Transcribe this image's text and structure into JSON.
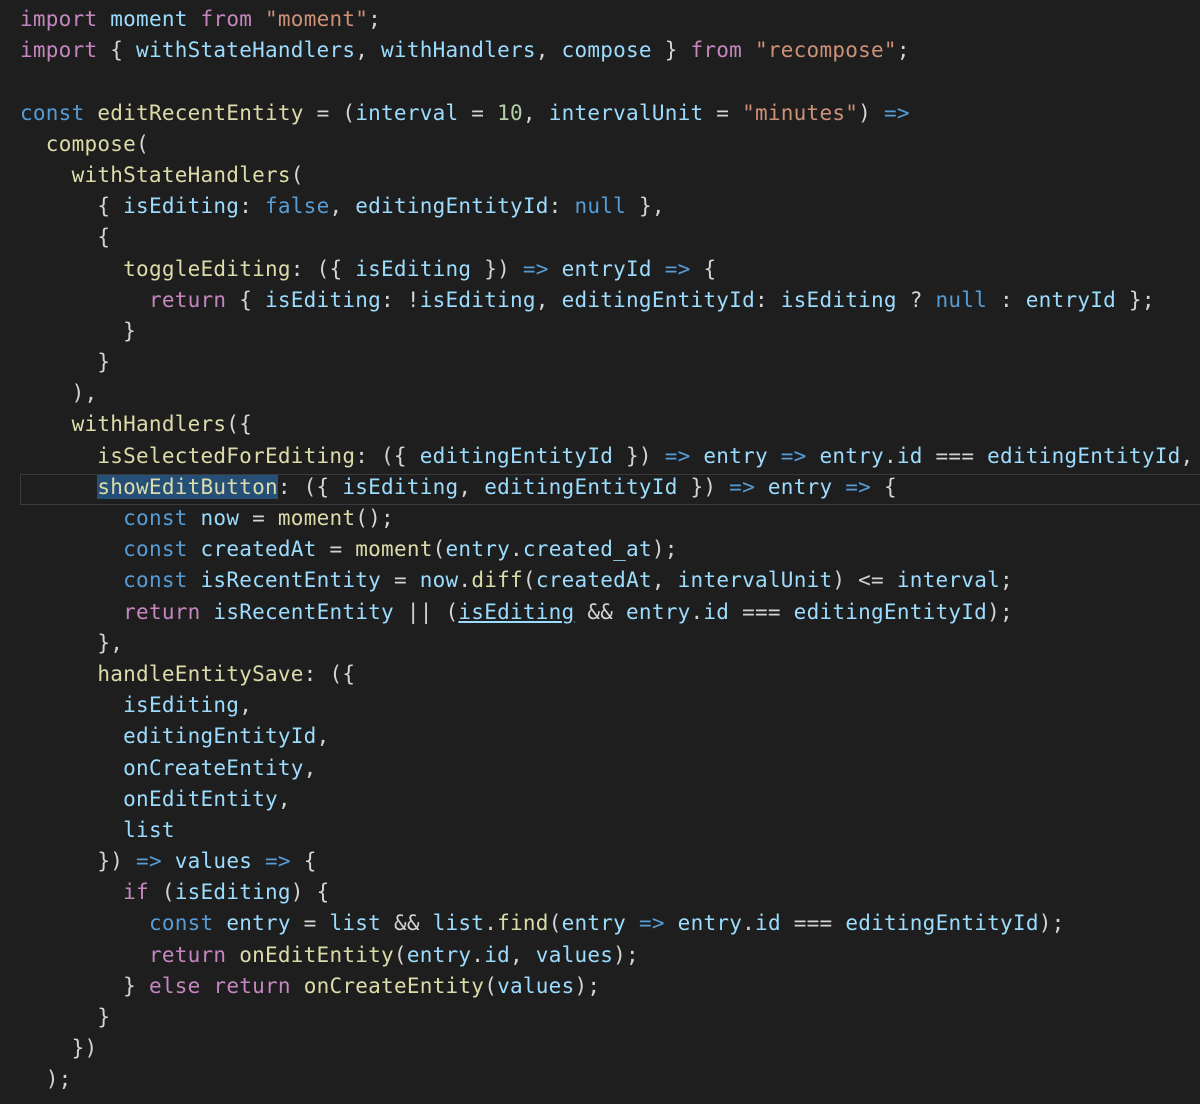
{
  "editor": {
    "theme_colors": {
      "background": "#1e1e1e",
      "keyword": "#c586c0",
      "storage": "#569cd6",
      "function": "#dcdcaa",
      "variable": "#9cdcfe",
      "string": "#ce9178",
      "number": "#b5cea8",
      "punctuation": "#d4d4d4"
    },
    "current_line": 16,
    "lines": [
      [
        [
          "kw",
          "import"
        ],
        [
          "pl",
          " "
        ],
        [
          "vr",
          "moment"
        ],
        [
          "pl",
          " "
        ],
        [
          "kw",
          "from"
        ],
        [
          "pl",
          " "
        ],
        [
          "str",
          "\"moment\""
        ],
        [
          "pl",
          ";"
        ]
      ],
      [
        [
          "kw",
          "import"
        ],
        [
          "pl",
          " { "
        ],
        [
          "vr",
          "withStateHandlers"
        ],
        [
          "pl",
          ", "
        ],
        [
          "vr",
          "withHandlers"
        ],
        [
          "pl",
          ", "
        ],
        [
          "vr",
          "compose"
        ],
        [
          "pl",
          " } "
        ],
        [
          "kw",
          "from"
        ],
        [
          "pl",
          " "
        ],
        [
          "str",
          "\"recompose\""
        ],
        [
          "pl",
          ";"
        ]
      ],
      [
        [
          "pl",
          ""
        ]
      ],
      [
        [
          "st",
          "const"
        ],
        [
          "pl",
          " "
        ],
        [
          "fn",
          "editRecentEntity"
        ],
        [
          "pl",
          " = ("
        ],
        [
          "vr",
          "interval"
        ],
        [
          "pl",
          " = "
        ],
        [
          "num",
          "10"
        ],
        [
          "pl",
          ", "
        ],
        [
          "vr",
          "intervalUnit"
        ],
        [
          "pl",
          " = "
        ],
        [
          "str",
          "\"minutes\""
        ],
        [
          "pl",
          ") "
        ],
        [
          "ar",
          "=>"
        ]
      ],
      [
        [
          "pl",
          "  "
        ],
        [
          "fn",
          "compose"
        ],
        [
          "pl",
          "("
        ]
      ],
      [
        [
          "pl",
          "    "
        ],
        [
          "fn",
          "withStateHandlers"
        ],
        [
          "pl",
          "("
        ]
      ],
      [
        [
          "pl",
          "      { "
        ],
        [
          "vr",
          "isEditing"
        ],
        [
          "pl",
          ": "
        ],
        [
          "st",
          "false"
        ],
        [
          "pl",
          ", "
        ],
        [
          "vr",
          "editingEntityId"
        ],
        [
          "pl",
          ": "
        ],
        [
          "st",
          "null"
        ],
        [
          "pl",
          " },"
        ]
      ],
      [
        [
          "pl",
          "      {"
        ]
      ],
      [
        [
          "pl",
          "        "
        ],
        [
          "fn",
          "toggleEditing"
        ],
        [
          "pl",
          ": ({ "
        ],
        [
          "vr",
          "isEditing"
        ],
        [
          "pl",
          " }) "
        ],
        [
          "ar",
          "=>"
        ],
        [
          "pl",
          " "
        ],
        [
          "vr",
          "entryId"
        ],
        [
          "pl",
          " "
        ],
        [
          "ar",
          "=>"
        ],
        [
          "pl",
          " {"
        ]
      ],
      [
        [
          "pl",
          "          "
        ],
        [
          "kw",
          "return"
        ],
        [
          "pl",
          " { "
        ],
        [
          "vr",
          "isEditing"
        ],
        [
          "pl",
          ": !"
        ],
        [
          "vr",
          "isEditing"
        ],
        [
          "pl",
          ", "
        ],
        [
          "vr",
          "editingEntityId"
        ],
        [
          "pl",
          ": "
        ],
        [
          "vr",
          "isEditing"
        ],
        [
          "pl",
          " ? "
        ],
        [
          "st",
          "null"
        ],
        [
          "pl",
          " : "
        ],
        [
          "vr",
          "entryId"
        ],
        [
          "pl",
          " };"
        ]
      ],
      [
        [
          "pl",
          "        }"
        ]
      ],
      [
        [
          "pl",
          "      }"
        ]
      ],
      [
        [
          "pl",
          "    ),"
        ]
      ],
      [
        [
          "pl",
          "    "
        ],
        [
          "fn",
          "withHandlers"
        ],
        [
          "pl",
          "({"
        ]
      ],
      [
        [
          "pl",
          "      "
        ],
        [
          "fn",
          "isSelectedForEditing"
        ],
        [
          "pl",
          ": ({ "
        ],
        [
          "vr",
          "editingEntityId"
        ],
        [
          "pl",
          " }) "
        ],
        [
          "ar",
          "=>"
        ],
        [
          "pl",
          " "
        ],
        [
          "vr",
          "entry"
        ],
        [
          "pl",
          " "
        ],
        [
          "ar",
          "=>"
        ],
        [
          "pl",
          " "
        ],
        [
          "vr",
          "entry"
        ],
        [
          "pl",
          "."
        ],
        [
          "vr",
          "id"
        ],
        [
          "pl",
          " === "
        ],
        [
          "vr",
          "editingEntityId"
        ],
        [
          "pl",
          ","
        ]
      ],
      [
        [
          "pl",
          "      "
        ],
        [
          "hl",
          "showEditButton"
        ],
        [
          "pl",
          ": ({ "
        ],
        [
          "vr",
          "isEditing"
        ],
        [
          "pl",
          ", "
        ],
        [
          "vr",
          "editingEntityId"
        ],
        [
          "pl",
          " }) "
        ],
        [
          "ar",
          "=>"
        ],
        [
          "pl",
          " "
        ],
        [
          "vr",
          "entry"
        ],
        [
          "pl",
          " "
        ],
        [
          "ar",
          "=>"
        ],
        [
          "pl",
          " {"
        ]
      ],
      [
        [
          "pl",
          "        "
        ],
        [
          "st",
          "const"
        ],
        [
          "pl",
          " "
        ],
        [
          "vr",
          "now"
        ],
        [
          "pl",
          " = "
        ],
        [
          "fn",
          "moment"
        ],
        [
          "pl",
          "();"
        ]
      ],
      [
        [
          "pl",
          "        "
        ],
        [
          "st",
          "const"
        ],
        [
          "pl",
          " "
        ],
        [
          "vr",
          "createdAt"
        ],
        [
          "pl",
          " = "
        ],
        [
          "fn",
          "moment"
        ],
        [
          "pl",
          "("
        ],
        [
          "vr",
          "entry"
        ],
        [
          "pl",
          "."
        ],
        [
          "vr",
          "created_at"
        ],
        [
          "pl",
          ");"
        ]
      ],
      [
        [
          "pl",
          "        "
        ],
        [
          "st",
          "const"
        ],
        [
          "pl",
          " "
        ],
        [
          "vr",
          "isRecentEntity"
        ],
        [
          "pl",
          " = "
        ],
        [
          "vr",
          "now"
        ],
        [
          "pl",
          "."
        ],
        [
          "fn",
          "diff"
        ],
        [
          "pl",
          "("
        ],
        [
          "vr",
          "createdAt"
        ],
        [
          "pl",
          ", "
        ],
        [
          "vr",
          "intervalUnit"
        ],
        [
          "pl",
          ") <= "
        ],
        [
          "vr",
          "interval"
        ],
        [
          "pl",
          ";"
        ]
      ],
      [
        [
          "pl",
          "        "
        ],
        [
          "kw",
          "return"
        ],
        [
          "pl",
          " "
        ],
        [
          "vr",
          "isRecentEntity"
        ],
        [
          "pl",
          " || ("
        ],
        [
          "link",
          "isEditing"
        ],
        [
          "pl",
          " && "
        ],
        [
          "vr",
          "entry"
        ],
        [
          "pl",
          "."
        ],
        [
          "vr",
          "id"
        ],
        [
          "pl",
          " === "
        ],
        [
          "vr",
          "editingEntityId"
        ],
        [
          "pl",
          ");"
        ]
      ],
      [
        [
          "pl",
          "      },"
        ]
      ],
      [
        [
          "pl",
          "      "
        ],
        [
          "fn",
          "handleEntitySave"
        ],
        [
          "pl",
          ": ({"
        ]
      ],
      [
        [
          "pl",
          "        "
        ],
        [
          "vr",
          "isEditing"
        ],
        [
          "pl",
          ","
        ]
      ],
      [
        [
          "pl",
          "        "
        ],
        [
          "vr",
          "editingEntityId"
        ],
        [
          "pl",
          ","
        ]
      ],
      [
        [
          "pl",
          "        "
        ],
        [
          "vr",
          "onCreateEntity"
        ],
        [
          "pl",
          ","
        ]
      ],
      [
        [
          "pl",
          "        "
        ],
        [
          "vr",
          "onEditEntity"
        ],
        [
          "pl",
          ","
        ]
      ],
      [
        [
          "pl",
          "        "
        ],
        [
          "vr",
          "list"
        ]
      ],
      [
        [
          "pl",
          "      }) "
        ],
        [
          "ar",
          "=>"
        ],
        [
          "pl",
          " "
        ],
        [
          "vr",
          "values"
        ],
        [
          "pl",
          " "
        ],
        [
          "ar",
          "=>"
        ],
        [
          "pl",
          " {"
        ]
      ],
      [
        [
          "pl",
          "        "
        ],
        [
          "kw",
          "if"
        ],
        [
          "pl",
          " ("
        ],
        [
          "vr",
          "isEditing"
        ],
        [
          "pl",
          ") {"
        ]
      ],
      [
        [
          "pl",
          "          "
        ],
        [
          "st",
          "const"
        ],
        [
          "pl",
          " "
        ],
        [
          "vr",
          "entry"
        ],
        [
          "pl",
          " = "
        ],
        [
          "vr",
          "list"
        ],
        [
          "pl",
          " && "
        ],
        [
          "vr",
          "list"
        ],
        [
          "pl",
          "."
        ],
        [
          "fn",
          "find"
        ],
        [
          "pl",
          "("
        ],
        [
          "vr",
          "entry"
        ],
        [
          "pl",
          " "
        ],
        [
          "ar",
          "=>"
        ],
        [
          "pl",
          " "
        ],
        [
          "vr",
          "entry"
        ],
        [
          "pl",
          "."
        ],
        [
          "vr",
          "id"
        ],
        [
          "pl",
          " === "
        ],
        [
          "vr",
          "editingEntityId"
        ],
        [
          "pl",
          ");"
        ]
      ],
      [
        [
          "pl",
          "          "
        ],
        [
          "kw",
          "return"
        ],
        [
          "pl",
          " "
        ],
        [
          "fn",
          "onEditEntity"
        ],
        [
          "pl",
          "("
        ],
        [
          "vr",
          "entry"
        ],
        [
          "pl",
          "."
        ],
        [
          "vr",
          "id"
        ],
        [
          "pl",
          ", "
        ],
        [
          "vr",
          "values"
        ],
        [
          "pl",
          ");"
        ]
      ],
      [
        [
          "pl",
          "        } "
        ],
        [
          "kw",
          "else"
        ],
        [
          "pl",
          " "
        ],
        [
          "kw",
          "return"
        ],
        [
          "pl",
          " "
        ],
        [
          "fn",
          "onCreateEntity"
        ],
        [
          "pl",
          "("
        ],
        [
          "vr",
          "values"
        ],
        [
          "pl",
          ");"
        ]
      ],
      [
        [
          "pl",
          "      }"
        ]
      ],
      [
        [
          "pl",
          "    })"
        ]
      ],
      [
        [
          "pl",
          "  );"
        ]
      ]
    ]
  }
}
